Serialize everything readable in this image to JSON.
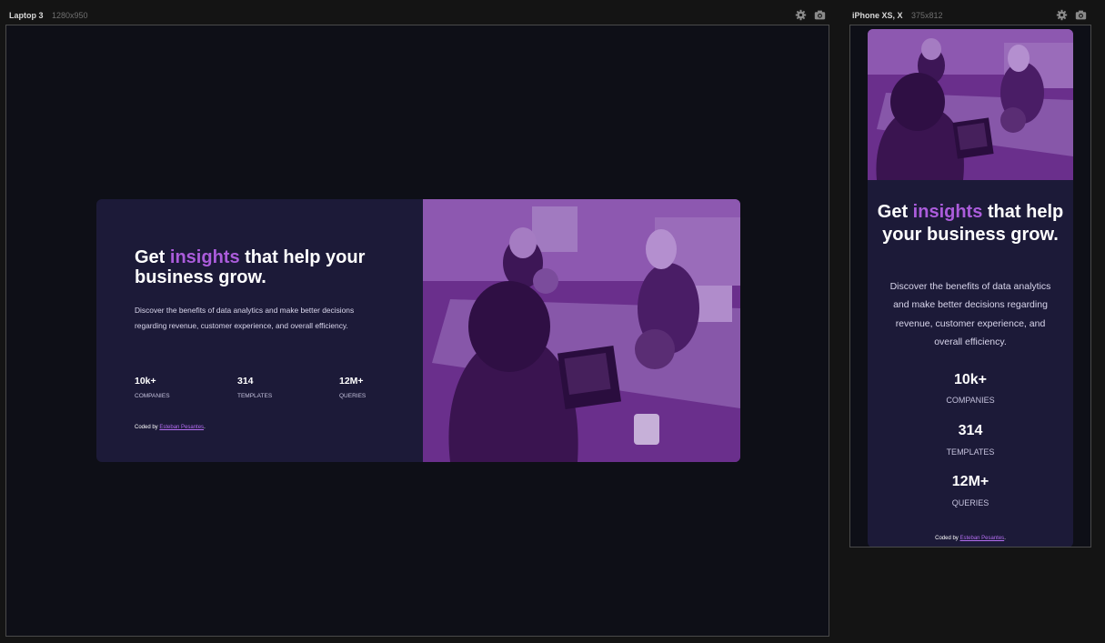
{
  "toolbar": {
    "laptop": {
      "name": "Laptop 3",
      "size": "1280x950"
    },
    "phone": {
      "name": "iPhone XS, X",
      "size": "375x812"
    },
    "icons": [
      "gear-icon",
      "camera-icon"
    ]
  },
  "hero": {
    "title_before": "Get ",
    "title_accent": "insights",
    "title_after": " that help your business grow.",
    "description": "Discover the benefits of data analytics and make better decisions regarding revenue, customer experience, and overall efficiency.",
    "stats": [
      {
        "value": "10k+",
        "label": "COMPANIES"
      },
      {
        "value": "314",
        "label": "TEMPLATES"
      },
      {
        "value": "12M+",
        "label": "QUERIES"
      }
    ],
    "credit_prefix": "Coded by ",
    "credit_name": "Esteban Pesantes",
    "credit_suffix": "."
  },
  "colors": {
    "page_bg": "#0e0f17",
    "card_bg": "#1c1a38",
    "accent": "#ab5cdb",
    "image_tint": "#6b2e8e"
  }
}
